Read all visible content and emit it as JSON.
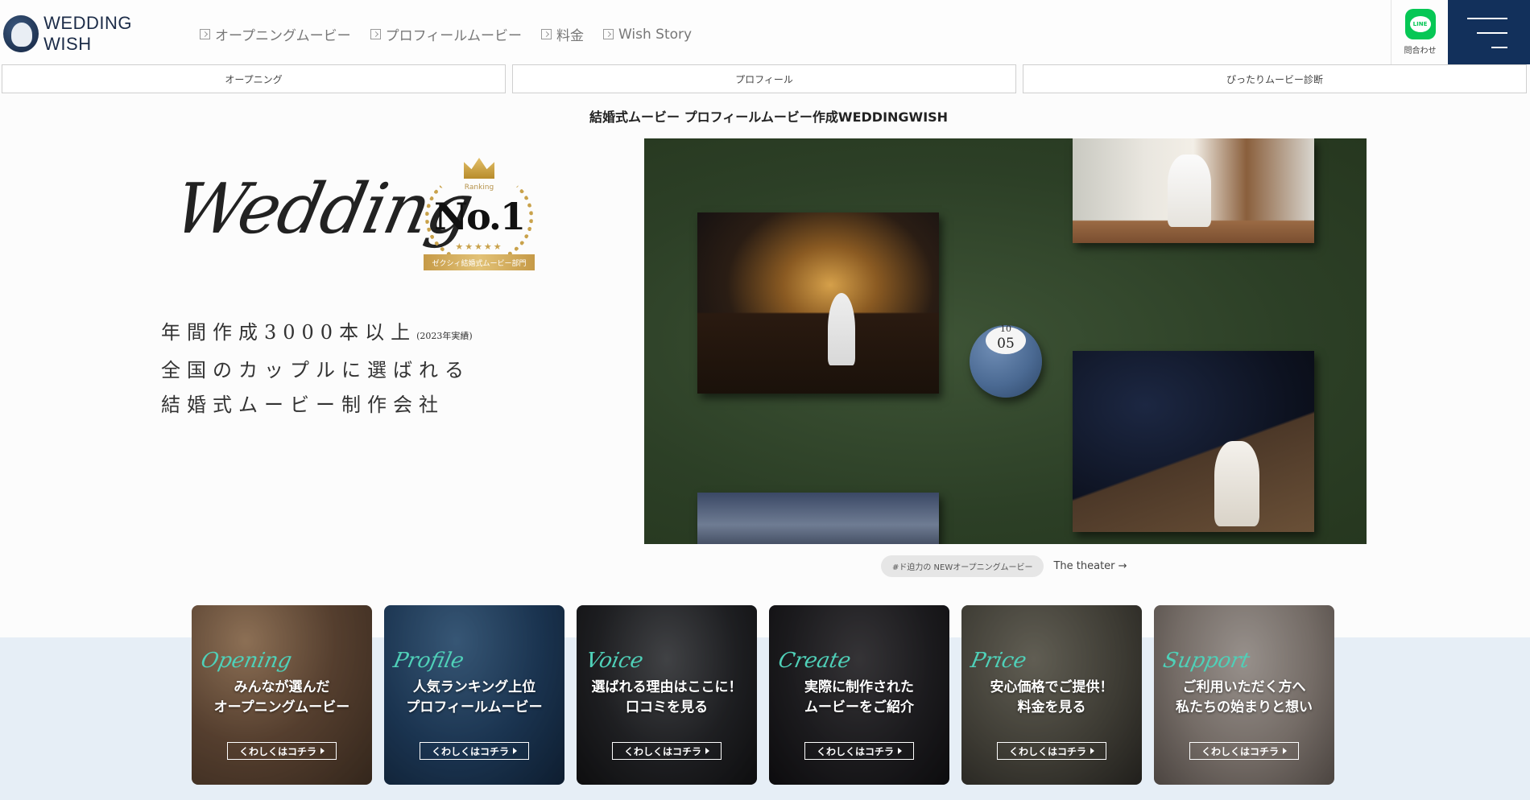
{
  "header": {
    "logo": {
      "line1": "WEDDING",
      "line2": "WISH"
    },
    "nav": [
      {
        "label": "オープニングムービー"
      },
      {
        "label": "プロフィールムービー"
      },
      {
        "label": "料金"
      },
      {
        "label": "Wish Story"
      }
    ],
    "line": {
      "icon_text": "LINE",
      "label": "問合わせ",
      "color": "#06c755"
    },
    "menu_color": "#12305b"
  },
  "subtabs": [
    {
      "label": "オープニング"
    },
    {
      "label": "プロフィール"
    },
    {
      "label": "ぴったりムービー診断"
    }
  ],
  "hero": {
    "caption": "結婚式ムービー プロフィールムービー作成WEDDINGWISH",
    "script": "Wedding",
    "badge": {
      "ranking": "Ranking",
      "no1": "No.1",
      "stars": "★★★★★",
      "ribbon": "ゼクシィ結婚式ムービー部門"
    },
    "tagline": {
      "line1": "年間作成3000本以上",
      "line1_note": "(2023年実績)",
      "line2": "全国のカップルに選ばれる",
      "line3": "結婚式ムービー制作会社"
    }
  },
  "video": {
    "counter": "05",
    "hashtag": "#ド迫力の NEWオープニングムービー",
    "theater_link": "The theater →"
  },
  "cards": [
    {
      "script": "Opening",
      "title": "みんなが選んだ\nオープニングムービー",
      "more": "くわしくはコチラ"
    },
    {
      "script": "Profile",
      "title": "人気ランキング上位\nプロフィールムービー",
      "more": "くわしくはコチラ"
    },
    {
      "script": "Voice",
      "title": "選ばれる理由はここに！\n口コミを見る",
      "more": "くわしくはコチラ"
    },
    {
      "script": "Create",
      "title": "実際に制作された\nムービーをご紹介",
      "more": "くわしくはコチラ"
    },
    {
      "script": "Price",
      "title": "安心価格でご提供！\n料金を見る",
      "more": "くわしくはコチラ"
    },
    {
      "script": "Support",
      "title": "ご利用いただく方へ\n私たちの始まりと想い",
      "more": "くわしくはコチラ"
    }
  ]
}
